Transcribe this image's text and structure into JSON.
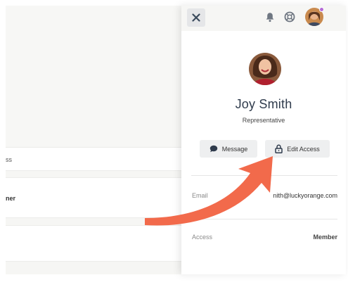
{
  "background": {
    "row1_text": "ss",
    "row2_text": "ner"
  },
  "header": {
    "close_icon": "close-icon",
    "notification_icon": "bell-icon",
    "help_icon": "lifebuoy-icon",
    "presence_color": "#b46bd6"
  },
  "profile": {
    "name": "Joy Smith",
    "role": "Representative"
  },
  "actions": {
    "message_label": "Message",
    "edit_access_label": "Edit Access"
  },
  "fields": {
    "email_label": "Email",
    "email_value": "nith@luckyorange.com",
    "access_label": "Access",
    "access_value": "Member"
  },
  "colors": {
    "arrow": "#f26a4b",
    "name_text": "#2f3b4c"
  }
}
